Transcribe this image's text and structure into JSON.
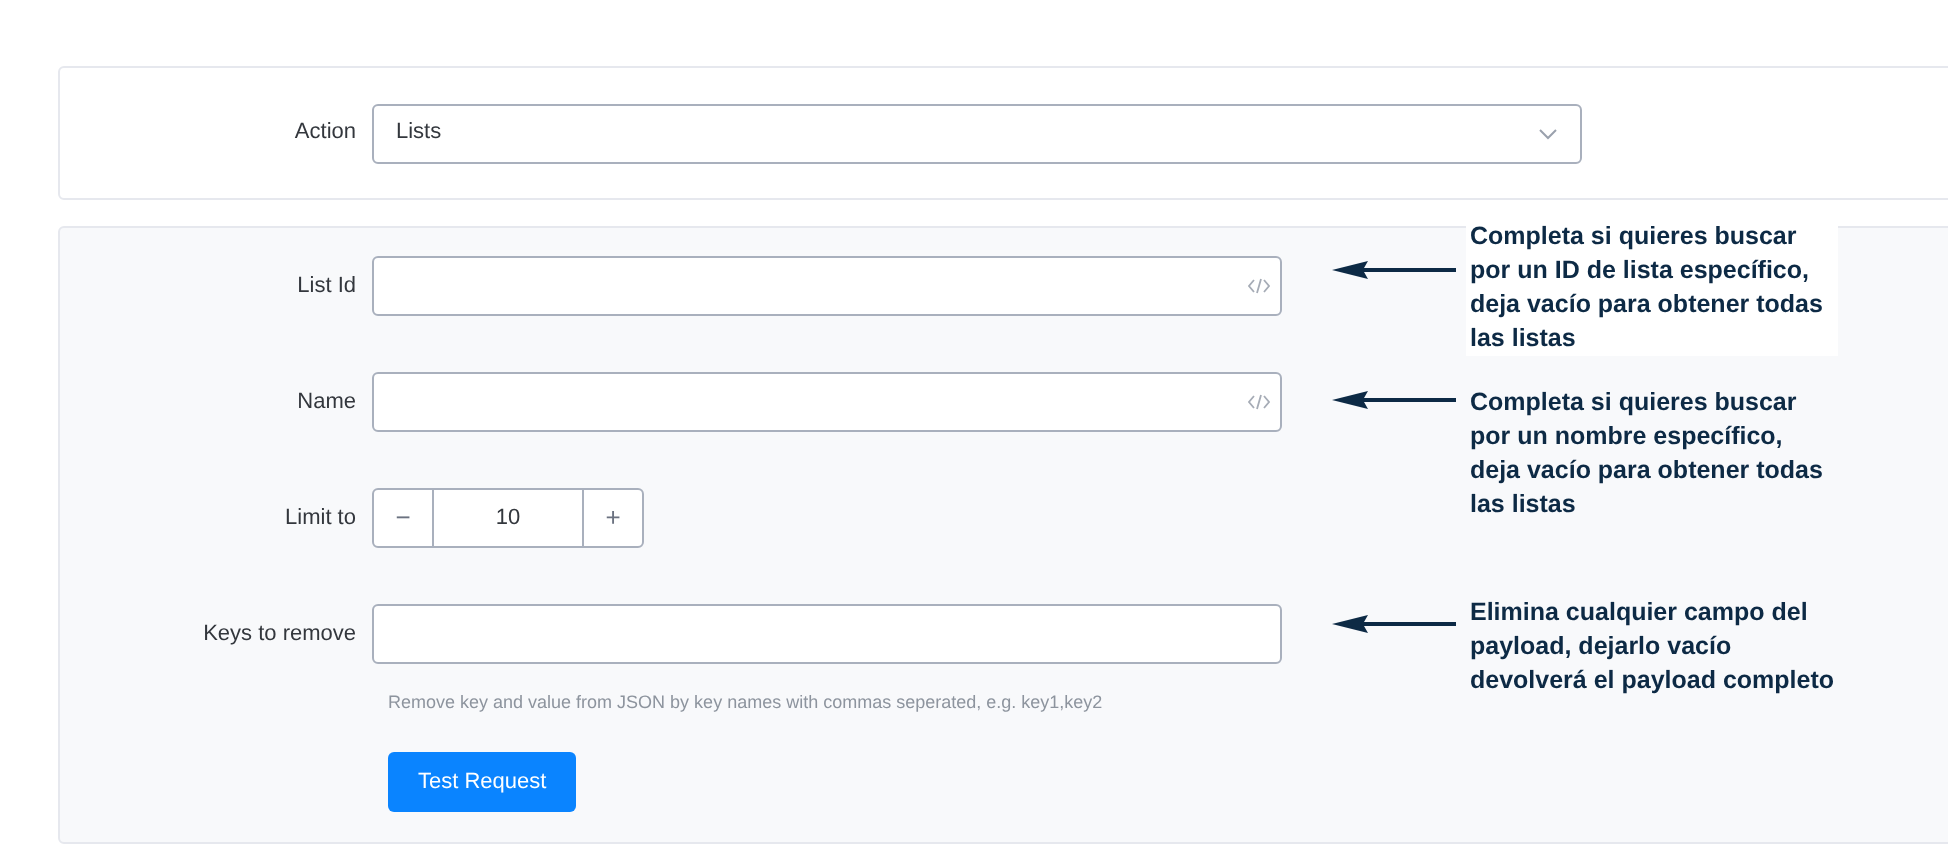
{
  "action": {
    "label": "Action",
    "value": "Lists"
  },
  "fields": [
    {
      "kind": "code",
      "label": "List Id"
    },
    {
      "kind": "code",
      "label": "Name"
    },
    {
      "kind": "stepper",
      "label": "Limit to",
      "value": "10",
      "minus": "−",
      "plus": "+"
    },
    {
      "kind": "text",
      "label": "Keys to remove",
      "help": "Remove key and value from JSON by key names with commas seperated, e.g. key1,key2"
    }
  ],
  "button": "Test Request",
  "notes": [
    {
      "text": "Completa si quieres buscar por un ID de lista específico, deja vacío para obtener todas las listas"
    },
    {
      "text": "Completa si quieres buscar por un nombre específico, deja vacío para obtener todas las listas"
    },
    {
      "text": "Elimina cualquier campo del payload, dejarlo vacío devolverá el payload completo"
    }
  ]
}
